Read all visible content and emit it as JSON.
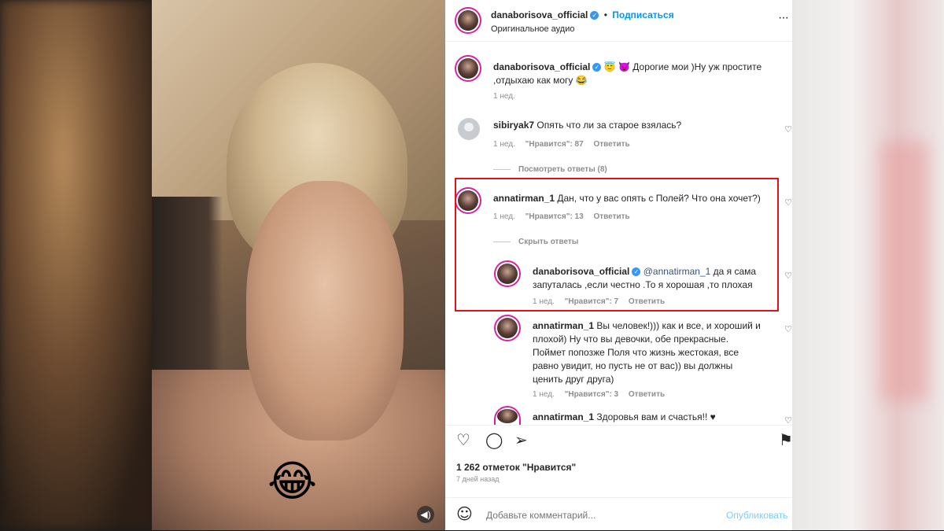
{
  "post": {
    "author": "danaborisova_official",
    "follow_label": "Подписаться",
    "audio_label": "Оригинальное аудио",
    "more_icon": "more-dots-icon",
    "sticker_emoji": "😂",
    "caption": {
      "username": "danaborisova_official",
      "text_line1": "😇 😈 Дорогие мои )Ну уж простите",
      "text_line2": ",отдыхаю как могу 😂",
      "time": "1 нед."
    }
  },
  "comments": [
    {
      "username": "sibiryak7",
      "text": "Опять что ли за старое взялась?",
      "time": "1 нед.",
      "likes": "\"Нравится\": 87",
      "reply_label": "Ответить",
      "thread_toggle": "Посмотреть ответы (8)"
    },
    {
      "username": "annatirman_1",
      "text": "Дан, что у вас опять с Полей? Что она хочет?)",
      "time": "1 нед.",
      "likes": "\"Нравится\": 13",
      "reply_label": "Ответить",
      "thread_toggle": "Скрыть ответы",
      "replies": [
        {
          "username": "danaborisova_official",
          "mention": "@annatirman_1",
          "text_line1": "да я сама",
          "text_line2": "запуталась ,если честно .То я хорошая ,то плохая",
          "time": "1 нед.",
          "likes": "\"Нравится\": 7",
          "reply_label": "Ответить"
        },
        {
          "username": "annatirman_1",
          "lines": [
            "Вы человек!))) как и все, и хороший и",
            "плохой) Ну что вы девочки, обе прекрасные.",
            "Поймет попозже Поля что жизнь жестокая, все",
            "равно увидит, но пусть не от вас)) вы должны",
            "ценить друг друга)"
          ],
          "time": "1 нед.",
          "likes": "\"Нравится\": 3",
          "reply_label": "Ответить"
        },
        {
          "username": "annatirman_1",
          "text": "Здоровья вам и счастья!! ♥"
        }
      ]
    }
  ],
  "actions": {
    "likes_count": "1 262 отметок \"Нравится\"",
    "posted_ago": "7 дней назад"
  },
  "composer": {
    "placeholder": "Добавьте комментарий...",
    "publish_label": "Опубликовать"
  }
}
